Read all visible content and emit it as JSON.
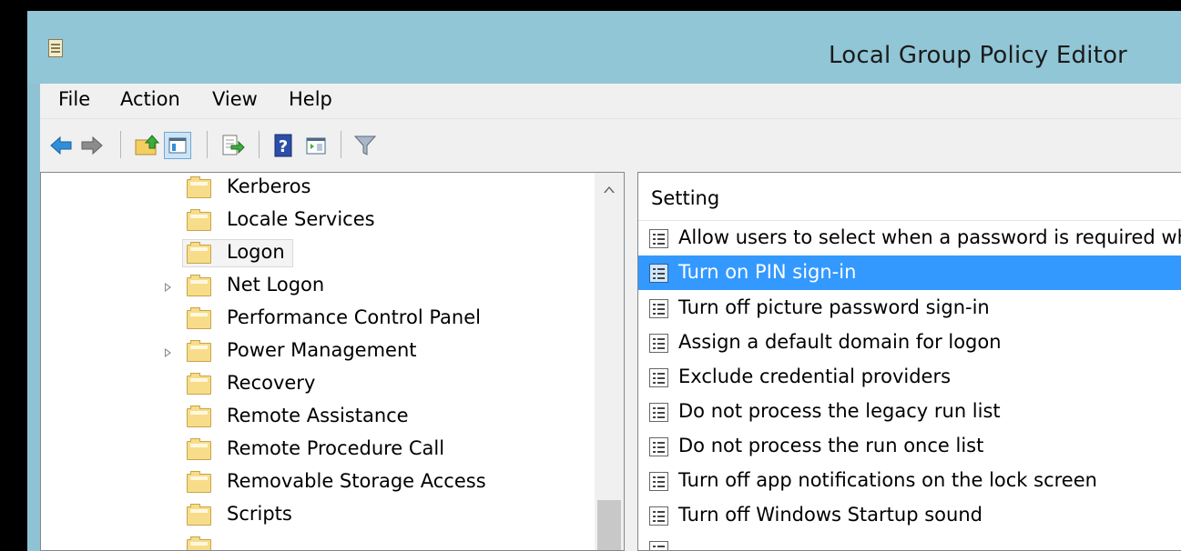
{
  "window": {
    "title": "Local Group Policy Editor"
  },
  "menu": [
    "File",
    "Action",
    "View",
    "Help"
  ],
  "toolbar": {
    "buttons": [
      "back-icon",
      "forward-icon",
      "up-folder-icon",
      "show-hide-tree-icon",
      "export-list-icon",
      "help-icon",
      "show-hide-action-pane-icon",
      "filter-icon"
    ]
  },
  "tree": {
    "items": [
      {
        "label": "Kerberos",
        "expandable": false,
        "selected": false
      },
      {
        "label": "Locale Services",
        "expandable": false,
        "selected": false
      },
      {
        "label": "Logon",
        "expandable": false,
        "selected": true
      },
      {
        "label": "Net Logon",
        "expandable": true,
        "selected": false
      },
      {
        "label": "Performance Control Panel",
        "expandable": false,
        "selected": false
      },
      {
        "label": "Power Management",
        "expandable": true,
        "selected": false
      },
      {
        "label": "Recovery",
        "expandable": false,
        "selected": false
      },
      {
        "label": "Remote Assistance",
        "expandable": false,
        "selected": false
      },
      {
        "label": "Remote Procedure Call",
        "expandable": false,
        "selected": false
      },
      {
        "label": "Removable Storage Access",
        "expandable": false,
        "selected": false
      },
      {
        "label": "Scripts",
        "expandable": false,
        "selected": false
      }
    ]
  },
  "settings": {
    "column_header": "Setting",
    "items": [
      {
        "label": "Allow users to select when a password is required wh",
        "selected": false
      },
      {
        "label": "Turn on PIN sign-in",
        "selected": true
      },
      {
        "label": "Turn off picture password sign-in",
        "selected": false
      },
      {
        "label": "Assign a default domain for logon",
        "selected": false
      },
      {
        "label": "Exclude credential providers",
        "selected": false
      },
      {
        "label": "Do not process the legacy run list",
        "selected": false
      },
      {
        "label": "Do not process the run once list",
        "selected": false
      },
      {
        "label": "Turn off app notifications on the lock screen",
        "selected": false
      },
      {
        "label": "Turn off Windows Startup sound",
        "selected": false
      }
    ]
  },
  "colors": {
    "titlebar": "#91c6d6",
    "selection": "#3399ff",
    "folder": "#f7dd8a"
  }
}
